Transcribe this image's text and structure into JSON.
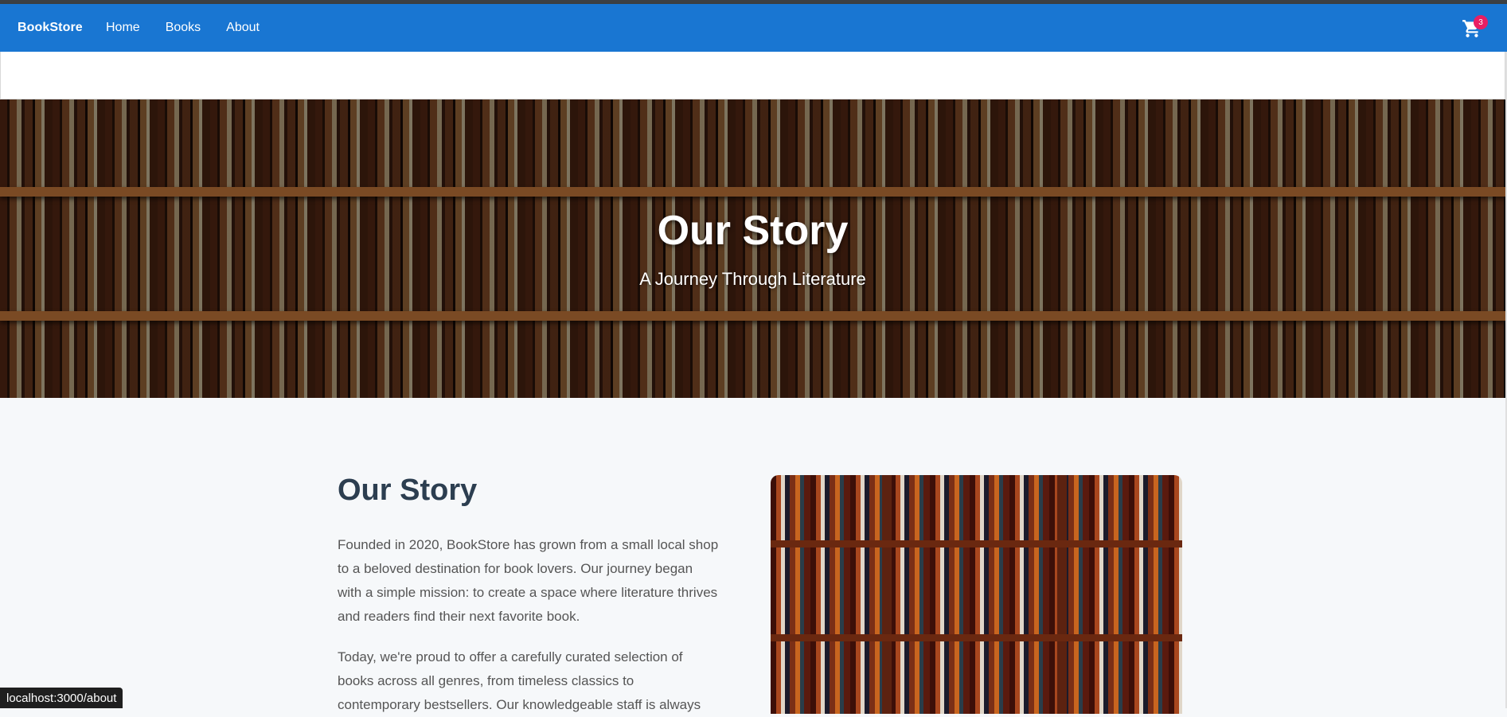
{
  "appbar": {
    "brand": "BookStore",
    "nav": [
      "Home",
      "Books",
      "About"
    ],
    "cart_icon": "cart-icon",
    "cart_count": "3"
  },
  "hero": {
    "title": "Our Story",
    "subtitle": "A Journey Through Literature"
  },
  "story": {
    "title": "Our Story",
    "paragraphs": [
      "Founded in 2020, BookStore has grown from a small local shop to a beloved destination for book lovers. Our journey began with a simple mission: to create a space where literature thrives and readers find their next favorite book.",
      "Today, we're proud to offer a carefully curated selection of books across all genres, from timeless classics to contemporary bestsellers. Our knowledgeable staff is always"
    ]
  },
  "status_bar": {
    "url": "localhost:3000/about"
  },
  "colors": {
    "appbar": "#1976d2",
    "badge": "#e91e63",
    "heading": "#2c3e50"
  }
}
